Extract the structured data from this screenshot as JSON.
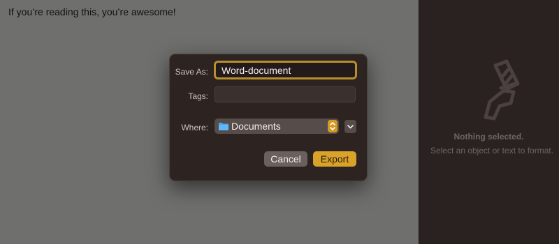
{
  "document": {
    "text": "If you’re reading this, you’re awesome!"
  },
  "format_panel": {
    "icon": "paintbrush-icon",
    "title": "Nothing selected.",
    "hint": "Select an object or text to format."
  },
  "dialog": {
    "save_as_label": "Save As:",
    "save_as_value": "Word-document",
    "tags_label": "Tags:",
    "tags_value": "",
    "where_label": "Where:",
    "where_value": "Documents",
    "where_icon": "folder-icon",
    "expand_icon": "chevron-down-icon",
    "cancel_label": "Cancel",
    "export_label": "Export"
  },
  "colors": {
    "accent": "#d9a228",
    "focus_ring": "#b88f2e",
    "dialog_bg": "#2d2321",
    "sidebar_bg": "#2a2221",
    "dimmed_canvas": "#6f6f6e"
  }
}
